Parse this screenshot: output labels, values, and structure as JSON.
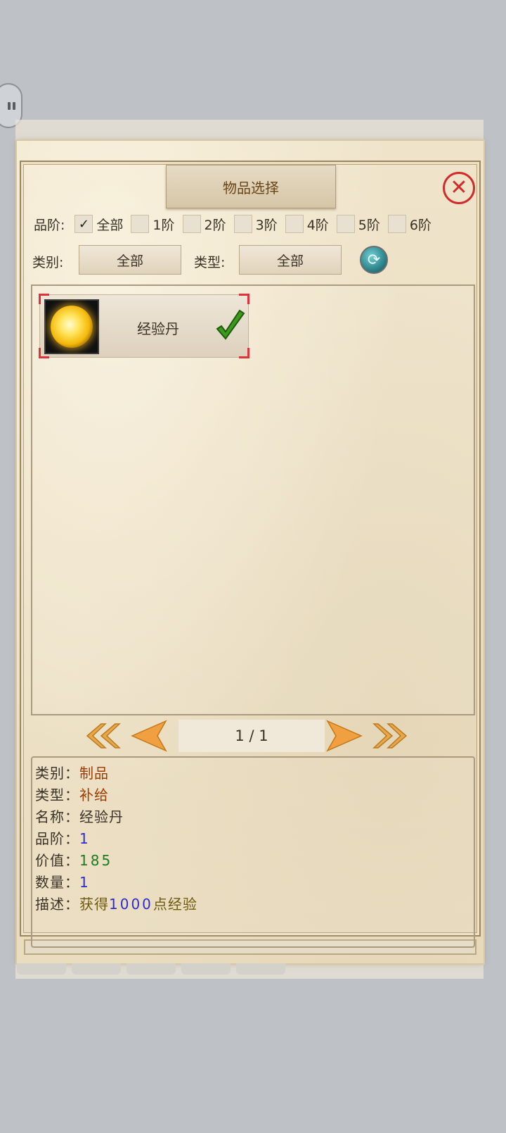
{
  "dialog": {
    "title": "物品选择"
  },
  "quality_filter": {
    "label": "品阶:",
    "options": [
      {
        "label": "全部",
        "checked": true
      },
      {
        "label": "1阶",
        "checked": false
      },
      {
        "label": "2阶",
        "checked": false
      },
      {
        "label": "3阶",
        "checked": false
      },
      {
        "label": "4阶",
        "checked": false
      },
      {
        "label": "5阶",
        "checked": false
      },
      {
        "label": "6阶",
        "checked": false
      }
    ],
    "check_mark": "✓"
  },
  "category_filter": {
    "label": "类别:",
    "value": "全部"
  },
  "type_filter": {
    "label": "类型:",
    "value": "全部"
  },
  "items": [
    {
      "name": "经验丹",
      "icon": "golden-orb-icon",
      "selected": true
    }
  ],
  "pager": {
    "text": "1 / 1"
  },
  "details": {
    "category": {
      "label": "类别：",
      "value": "制品"
    },
    "type": {
      "label": "类型：",
      "value": "补给"
    },
    "name": {
      "label": "名称：",
      "value": "经验丹"
    },
    "quality": {
      "label": "品阶：",
      "value": "1"
    },
    "price": {
      "label": "价值：",
      "value": "185"
    },
    "count": {
      "label": "数量：",
      "value": "1"
    },
    "desc": {
      "label": "描述：",
      "prefix": "获得",
      "amount": "1000",
      "suffix": "点经验"
    }
  },
  "colors": {
    "close": "#d12b2b",
    "selection_corner": "#e0323a",
    "value_brown": "#9c3c00",
    "value_blue": "#2b2bd6",
    "value_green": "#1f7a1f"
  }
}
